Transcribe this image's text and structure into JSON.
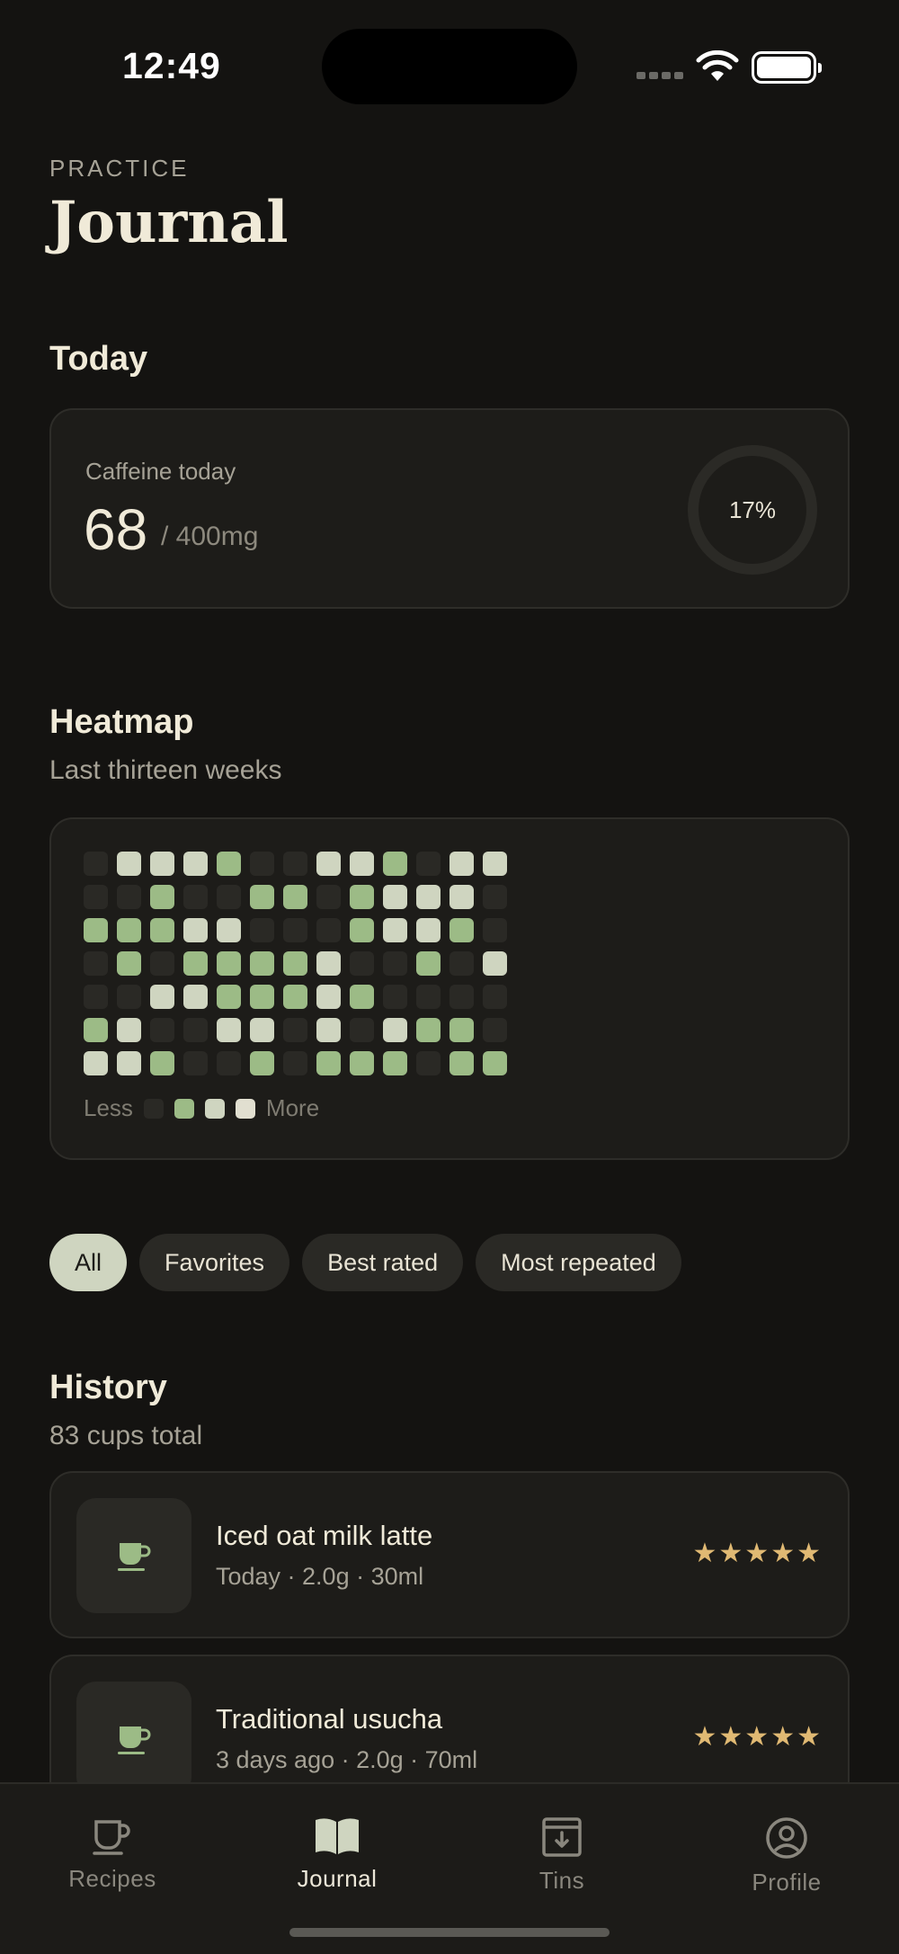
{
  "status_bar": {
    "time": "12:49"
  },
  "header": {
    "eyebrow": "PRACTICE",
    "title": "Journal"
  },
  "today": {
    "title": "Today",
    "caffeine_label": "Caffeine today",
    "caffeine_value": "68",
    "caffeine_limit": "/ 400mg",
    "progress_label": "17%",
    "progress_fraction": 0.17
  },
  "heatmap": {
    "title": "Heatmap",
    "subtitle": "Last thirteen weeks",
    "legend_less": "Less",
    "legend_more": "More",
    "weeks": [
      [
        0,
        0,
        1,
        0,
        0,
        1,
        2
      ],
      [
        2,
        0,
        1,
        1,
        0,
        2,
        2
      ],
      [
        2,
        1,
        1,
        0,
        2,
        0,
        1
      ],
      [
        2,
        0,
        2,
        1,
        2,
        0,
        0
      ],
      [
        1,
        0,
        2,
        1,
        1,
        2,
        0
      ],
      [
        0,
        1,
        0,
        1,
        1,
        2,
        1
      ],
      [
        0,
        1,
        0,
        1,
        1,
        0,
        0
      ],
      [
        2,
        0,
        0,
        2,
        2,
        2,
        1
      ],
      [
        2,
        1,
        1,
        0,
        1,
        0,
        1
      ],
      [
        1,
        2,
        2,
        0,
        0,
        2,
        1
      ],
      [
        0,
        2,
        2,
        1,
        0,
        1,
        0
      ],
      [
        2,
        2,
        1,
        0,
        0,
        1,
        1
      ],
      [
        2,
        0,
        0,
        2,
        0,
        0,
        1
      ]
    ]
  },
  "filters": [
    "All",
    "Favorites",
    "Best rated",
    "Most repeated"
  ],
  "history": {
    "title": "History",
    "subtitle": "83 cups total",
    "items": [
      {
        "title": "Iced oat milk latte",
        "meta": "Today · 2.0g · 30ml",
        "stars": "★★★★★",
        "rating": 5
      },
      {
        "title": "Traditional usucha",
        "meta": "3 days ago · 2.0g · 70ml",
        "stars": "★★★★★",
        "rating": 5
      }
    ]
  },
  "tabs": [
    {
      "label": "Recipes",
      "icon": "cup-icon"
    },
    {
      "label": "Journal",
      "icon": "book-icon"
    },
    {
      "label": "Tins",
      "icon": "archive-box-icon"
    },
    {
      "label": "Profile",
      "icon": "user-circle-icon"
    }
  ],
  "colors": {
    "accent_green": "#9cbb86",
    "pale_green": "#cfd5c0",
    "star_gold": "#e0b973",
    "background": "#141311"
  }
}
